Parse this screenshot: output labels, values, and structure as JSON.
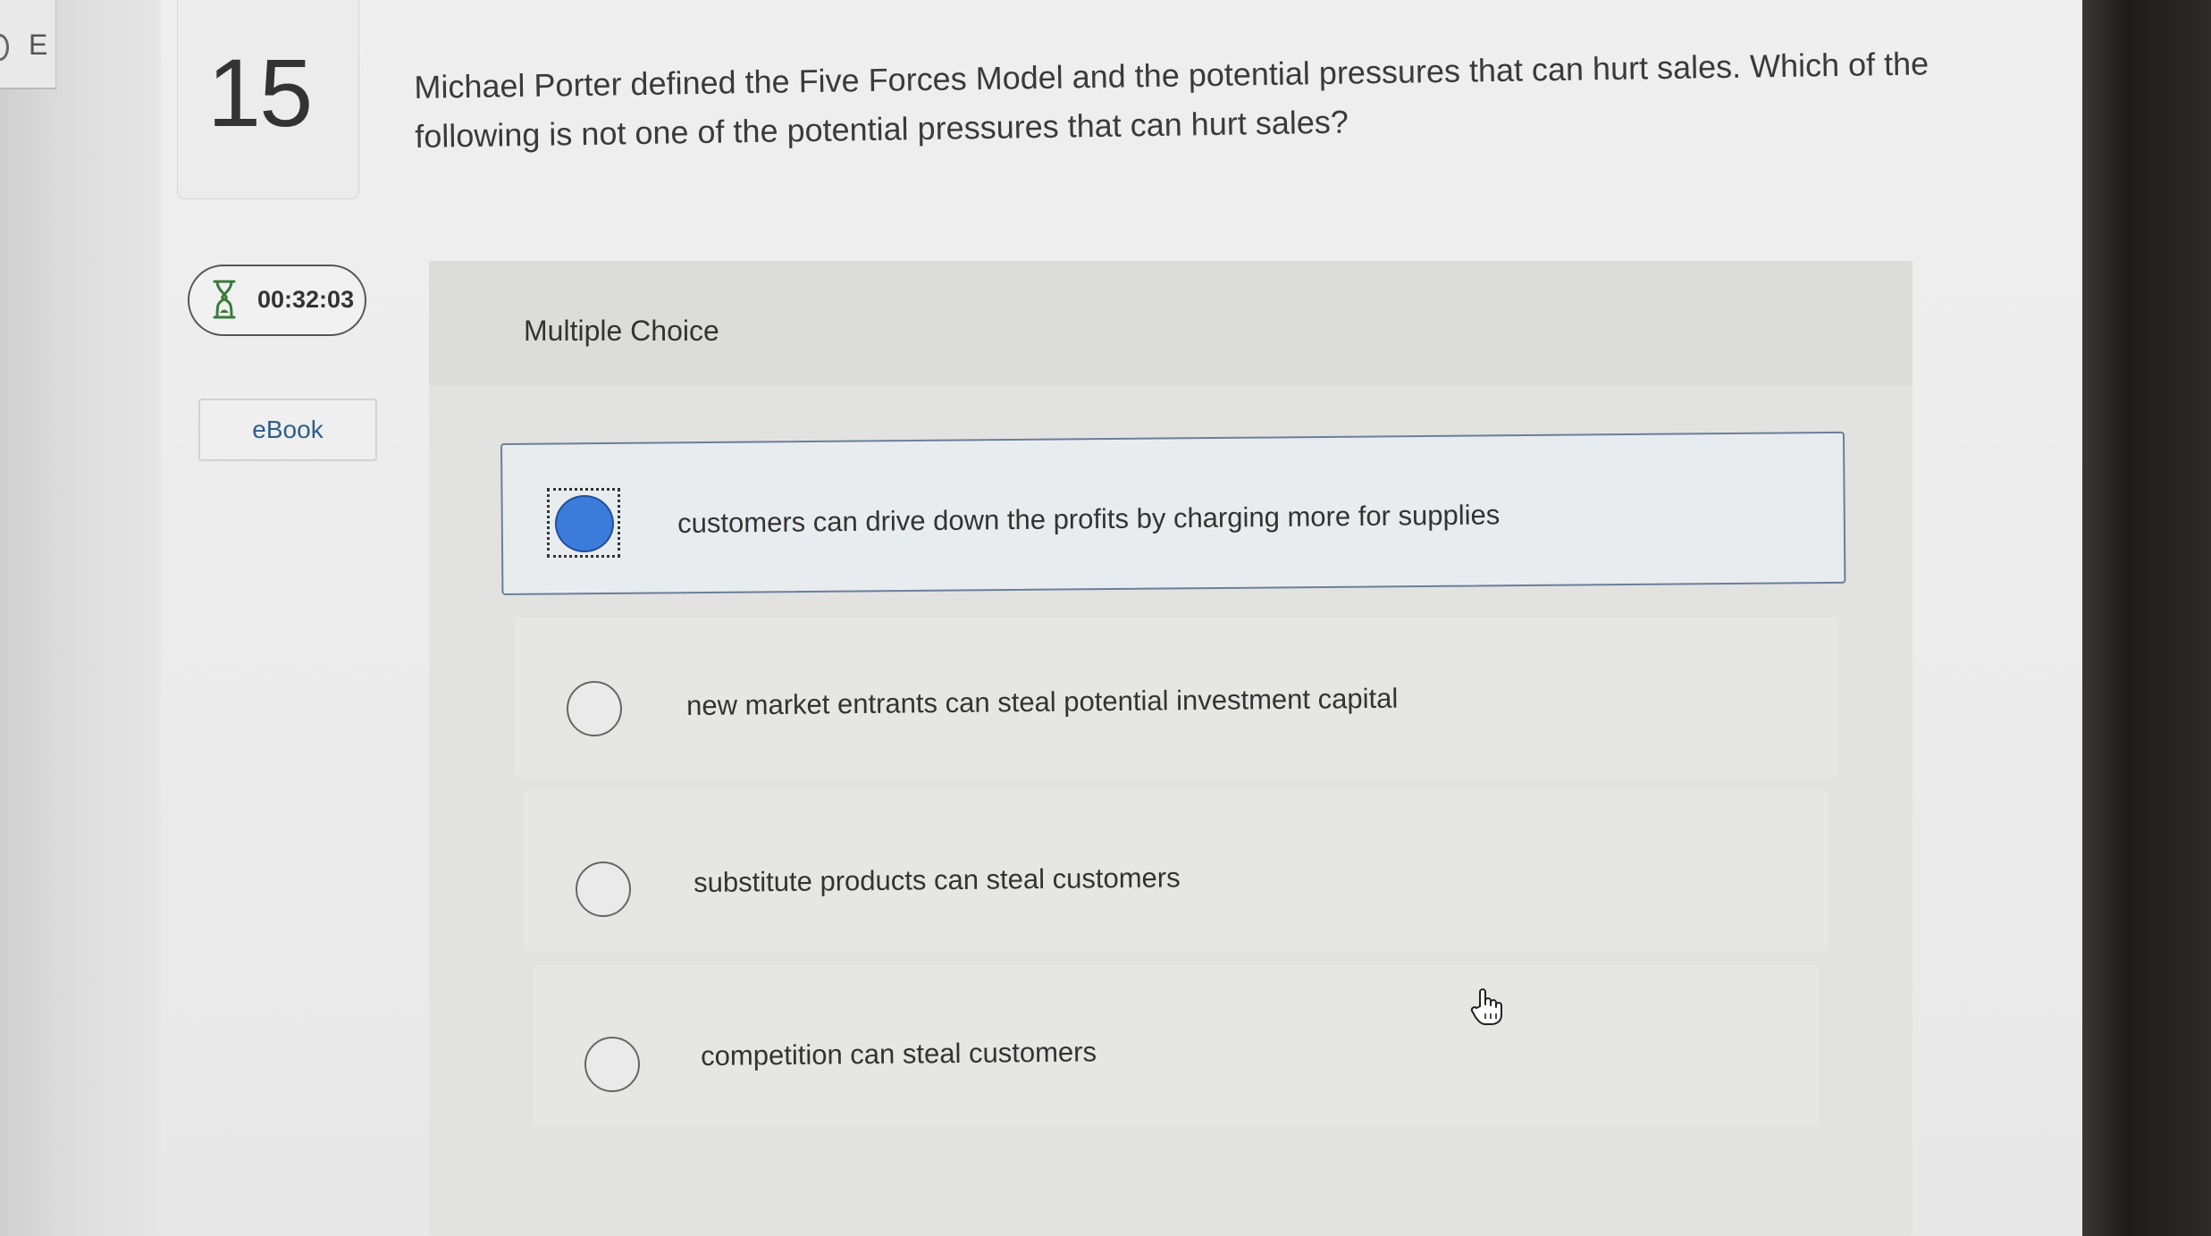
{
  "left_tab": {
    "label": "E"
  },
  "question": {
    "number": "15",
    "text": "Michael Porter defined the Five Forces Model and the potential pressures that can hurt sales. Which of the following is not one of the potential pressures that can hurt sales?"
  },
  "timer": {
    "icon": "hourglass-icon",
    "value": "00:32:03"
  },
  "ebook": {
    "label": "eBook"
  },
  "multiple_choice": {
    "label": "Multiple Choice",
    "options": [
      {
        "text": "customers can drive down the profits by charging more for supplies",
        "selected": true
      },
      {
        "text": "new market entrants can steal potential investment capital",
        "selected": false
      },
      {
        "text": "substitute products can steal customers",
        "selected": false
      },
      {
        "text": "competition can steal customers",
        "selected": false
      }
    ]
  },
  "colors": {
    "selected_radio": "#3b7bd9",
    "ebook_link": "#2f5f8c",
    "bezel": "#1e1c1b"
  }
}
